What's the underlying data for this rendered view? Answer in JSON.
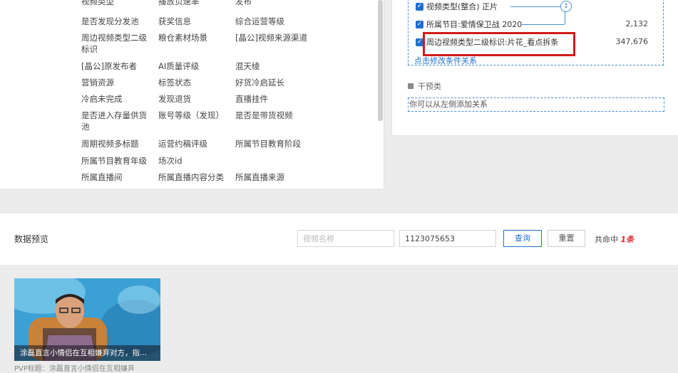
{
  "fields": [
    [
      "视频类型",
      "播放页速率",
      "发布"
    ],
    [
      "是否发现分发池",
      "获奖信息",
      "综合运营等级"
    ],
    [
      "周边视频类型二级标识",
      "粮仓素材场景",
      "[晶公]视频来源渠道"
    ],
    [
      "[晶公]原发布者",
      "AI质量评级",
      "混天绫"
    ],
    [
      "营销资源",
      "标签状态",
      "好货冷启延长"
    ],
    [
      "冷启未完成",
      "发现退货",
      "直播挂件"
    ],
    [
      "是否进入存量供货池",
      "账号等级（发现）",
      "是否是带货视频"
    ],
    [
      "周期视频多标题",
      "运营约稿评级",
      "所属节目教育阶段"
    ],
    [
      "所属节目教育年级",
      "场次id",
      ""
    ],
    [
      "所属直播间",
      "所属直播内容分类",
      "所属直播来源"
    ]
  ],
  "conditions": [
    {
      "label": "视频类型(整合) 正片",
      "count": ""
    },
    {
      "label": "所属节目:爱情保卫战 2020",
      "count": "2,132"
    },
    {
      "label": "周边视频类型二级标识:片花_看点拆条",
      "count": "347,676"
    }
  ],
  "edit_link": "点击修改条件关系",
  "section_label": "干预类",
  "hint_text": "你可以从左侧添加关系",
  "preview": {
    "title": "数据预览",
    "video_name_placeholder": "视频名称",
    "video_id_value": "1123075653",
    "query_label": "查询",
    "reset_label": "重置",
    "hit_prefix": "共命中",
    "hit_count": "1条"
  },
  "video": {
    "caption": "涂磊直言小情侣在互相嫌弃对方，指...",
    "subtitle": "PVP标题：涂磊直言小情侣在互相嫌弃"
  },
  "colors": {
    "accent": "#1f6fcf",
    "highlight": "#d21a1a",
    "dashed": "#4a90d9"
  }
}
